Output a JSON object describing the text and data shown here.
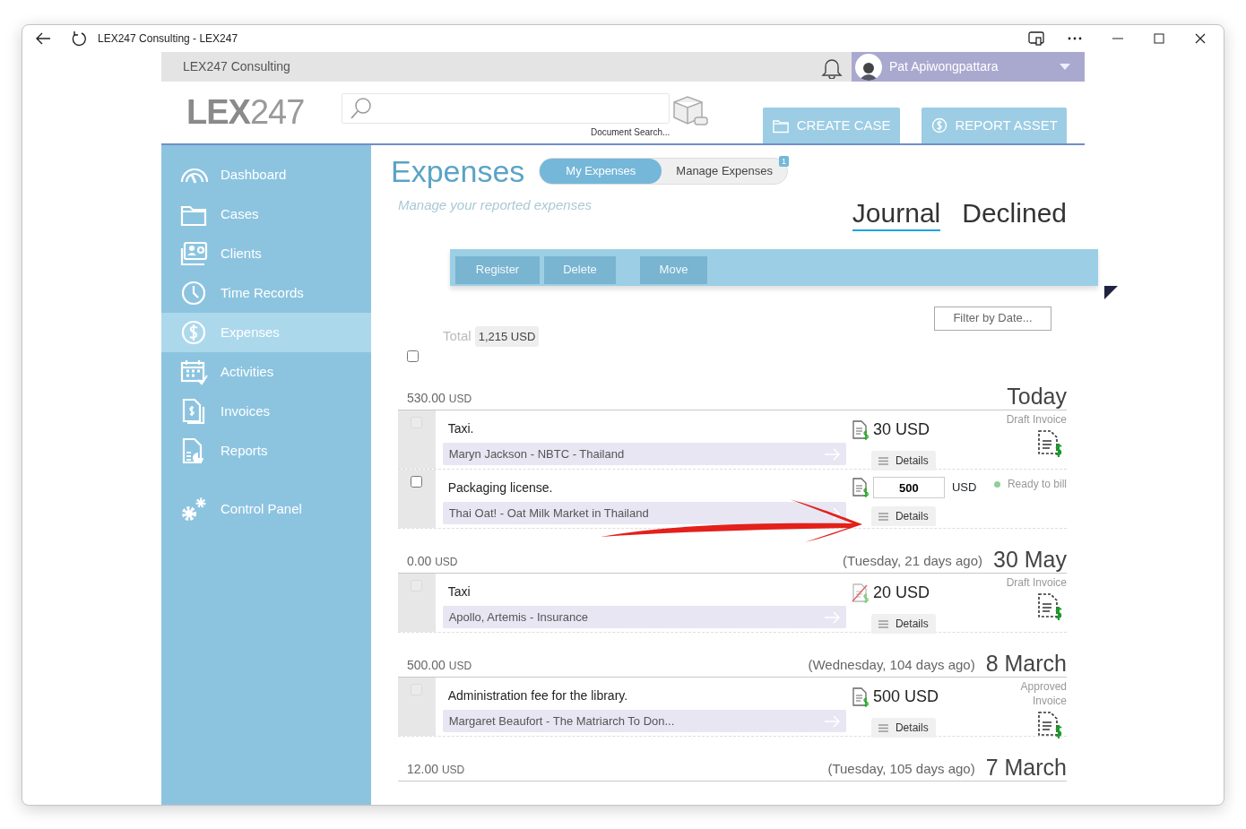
{
  "browser": {
    "title": "LEX247 Consulting - LEX247"
  },
  "topbar": {
    "org": "LEX247 Consulting",
    "user": "Pat Apiwongpattara"
  },
  "header": {
    "logo_bold": "LEX",
    "logo_light": "247",
    "caption": "Document Search...",
    "buttons": [
      {
        "label": "CREATE CASE"
      },
      {
        "label": "REPORT ASSET"
      }
    ]
  },
  "sidebar": {
    "items": [
      {
        "label": "Dashboard",
        "selected": false
      },
      {
        "label": "Cases",
        "selected": false
      },
      {
        "label": "Clients",
        "selected": false
      },
      {
        "label": "Time Records",
        "selected": false
      },
      {
        "label": "Expenses",
        "selected": true
      },
      {
        "label": "Activities",
        "selected": false
      },
      {
        "label": "Invoices",
        "selected": false
      },
      {
        "label": "Reports",
        "selected": false
      },
      {
        "label": "Control Panel",
        "selected": false
      }
    ]
  },
  "page": {
    "title": "Expenses",
    "subtitle": "Manage your reported expenses",
    "toggle": [
      {
        "label": "My Expenses",
        "selected": true
      },
      {
        "label": "Manage Expenses",
        "selected": false,
        "badge": "1"
      }
    ],
    "views": [
      {
        "label": "Journal",
        "selected": true
      },
      {
        "label": "Declined",
        "selected": false
      }
    ],
    "actions": [
      {
        "label": "Register",
        "disabled": true
      },
      {
        "label": "Delete",
        "disabled": true
      },
      {
        "label": "Move",
        "disabled": true
      }
    ],
    "filter": "Filter by Date...",
    "total_label": "Total",
    "total": "1,215 USD",
    "select_all_checked": false
  },
  "groups": [
    {
      "total": "530.00",
      "currency": "USD",
      "date": "Today",
      "items": [
        {
          "kind": "fixed",
          "title": "Taxi.",
          "client": "Maryn Jackson - NBTC - Thailand",
          "receipt_missing": false,
          "amount": "30 USD",
          "details": "Details",
          "status": "Draft Invoice",
          "checked": false,
          "disabled": true
        },
        {
          "kind": "input",
          "title": "Packaging license.",
          "client": "Thai Oat! - Oat Milk Market in Thailand",
          "receipt_missing": false,
          "amount": "500",
          "currency": "USD",
          "details": "Details",
          "status": "Ready to bill",
          "color": "#8fcf9a",
          "checked": false,
          "disabled": false
        }
      ]
    },
    {
      "total": "0.00",
      "currency": "USD",
      "day": "(Tuesday, 21 days ago)",
      "date": "30 May",
      "items": [
        {
          "kind": "fixed",
          "title": "Taxi",
          "client": "Apollo, Artemis - Insurance",
          "receipt_missing": true,
          "amount": "20 USD",
          "details": "Details",
          "status": "Draft Invoice",
          "checked": false,
          "disabled": true
        }
      ]
    },
    {
      "total": "500.00",
      "currency": "USD",
      "day": "(Wednesday, 104 days ago)",
      "date": "8 March",
      "items": [
        {
          "kind": "fixed",
          "title": "Administration fee for the library.",
          "client": "Margaret Beaufort - The Matriarch To Don...",
          "receipt_missing": false,
          "amount": "500 USD",
          "details": "Details",
          "status": "Approved Invoice",
          "checked": false,
          "disabled": true
        }
      ]
    },
    {
      "total": "12.00",
      "currency": "USD",
      "day": "(Tuesday, 105 days ago)",
      "date": "7 March"
    }
  ]
}
